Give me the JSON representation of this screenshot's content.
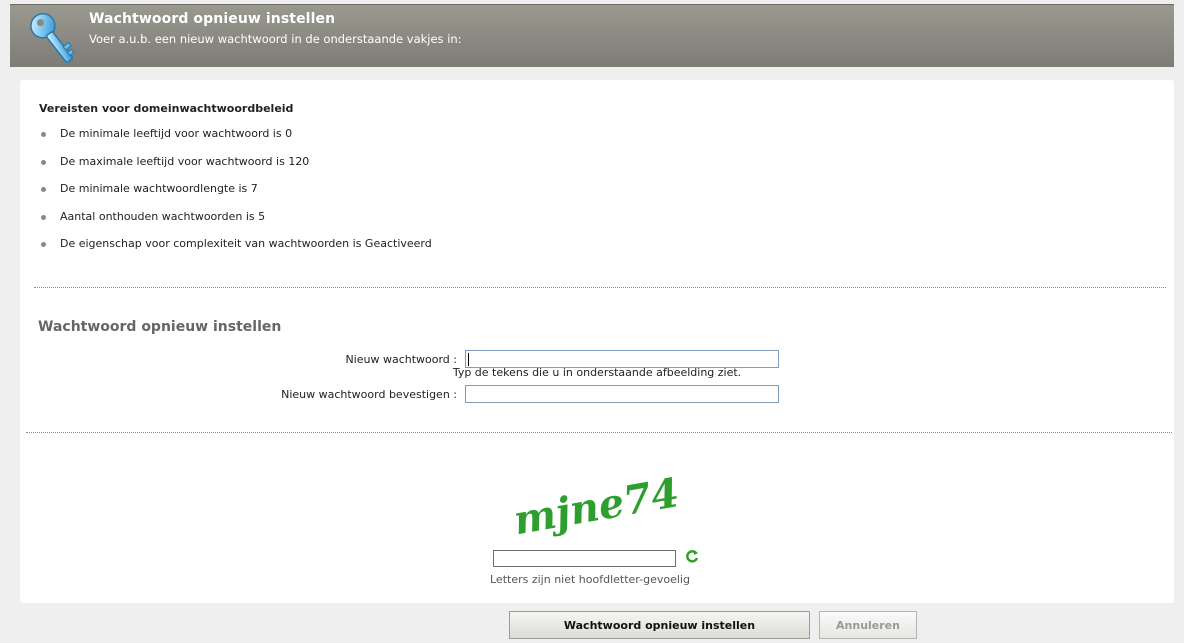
{
  "header": {
    "title": "Wachtwoord opnieuw instellen",
    "subtitle": "Voer a.u.b. een nieuw wachtwoord in de onderstaande vakjes in:"
  },
  "requirements": {
    "title": "Vereisten voor domeinwachtwoordbeleid",
    "items": [
      "De minimale leeftijd voor wachtwoord is 0",
      "De maximale leeftijd voor wachtwoord is 120",
      "De minimale wachtwoordlengte is 7",
      "Aantal onthouden wachtwoorden is 5",
      "De eigenschap voor complexiteit van wachtwoorden is Geactiveerd"
    ]
  },
  "reset_form": {
    "title": "Wachtwoord opnieuw instellen",
    "new_password_label": "Nieuw wachtwoord :",
    "confirm_password_label": "Nieuw wachtwoord bevestigen :",
    "new_password_value": "",
    "confirm_password_value": ""
  },
  "captcha": {
    "instruction": "Typ de tekens die u in onderstaande afbeelding ziet.",
    "image_text": "mjne74",
    "input_value": "",
    "hint": "Letters zijn niet hoofdletter-gevoelig",
    "refresh_icon": "refresh-icon"
  },
  "buttons": {
    "submit": "Wachtwoord opnieuw instellen",
    "cancel": "Annuleren"
  },
  "colors": {
    "header_bg": "#898880",
    "captcha_green": "#2e9f2e",
    "input_border": "#7f9db9"
  }
}
